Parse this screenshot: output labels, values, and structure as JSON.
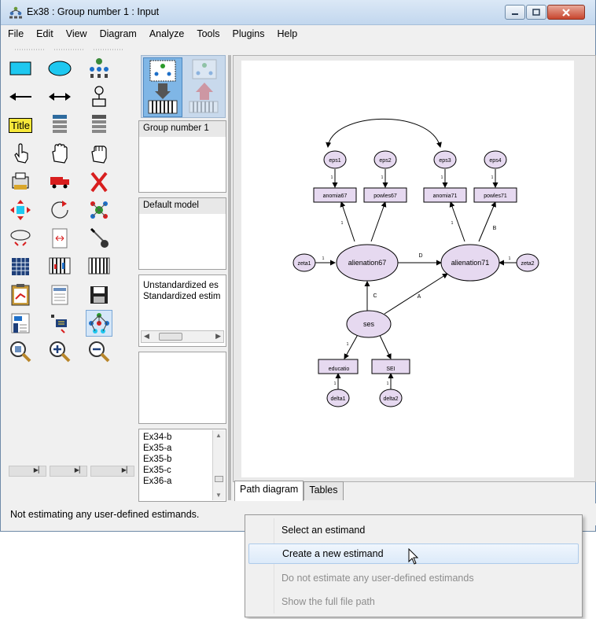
{
  "window": {
    "title": "Ex38 : Group number 1 : Input"
  },
  "menu": [
    "File",
    "Edit",
    "View",
    "Diagram",
    "Analyze",
    "Tools",
    "Plugins",
    "Help"
  ],
  "toolbox": {
    "title_tool_label": "Title",
    "icons": [
      "rectangle-icon",
      "ellipse-icon",
      "indicator-icon",
      "single-arrow-icon",
      "double-arrow-icon",
      "unique-variable-icon",
      "title-icon",
      "list-variables-icon",
      "list-dataset-icon",
      "select-one-icon",
      "select-all-icon",
      "deselect-all-icon",
      "duplicate-icon",
      "move-icon",
      "erase-icon",
      "shape-change-icon",
      "rotate-icon",
      "reflect-icon",
      "move-parameters-icon",
      "reposition-icon",
      "touch-up-icon",
      "data-files-icon",
      "analysis-properties-icon",
      "calculate-estimates-icon",
      "clipboard-icon",
      "text-output-icon",
      "save-icon",
      "object-properties-icon",
      "drag-properties-icon",
      "preserve-symmetries-icon",
      "zoom-select-icon",
      "zoom-in-icon",
      "zoom-out-icon"
    ]
  },
  "panels": {
    "groups": [
      "Group number 1"
    ],
    "models": [
      "Default model"
    ],
    "estimates": [
      "Unstandardized es",
      "Standardized estim"
    ],
    "files": [
      "Ex34-b",
      "Ex35-a",
      "Ex35-b",
      "Ex35-c",
      "Ex36-a"
    ]
  },
  "diagram": {
    "nodes": {
      "eps1": "eps1",
      "eps2": "eps2",
      "eps3": "eps3",
      "eps4": "eps4",
      "anomia67": "anomia67",
      "powles67": "powles67",
      "anomia71": "anomia71",
      "powles71": "powles71",
      "zeta1": "zeta1",
      "zeta2": "zeta2",
      "alienation67": "alienation67",
      "alienation71": "alienation71",
      "ses": "ses",
      "educatio": "educatio",
      "SEI": "SEI",
      "delta1": "delta1",
      "delta2": "delta2"
    },
    "path_labels": {
      "D": "D",
      "C": "C",
      "A": "A",
      "B": "B",
      "one": "1"
    }
  },
  "tabs": [
    "Path diagram",
    "Tables"
  ],
  "status": "Not estimating any user-defined estimands.",
  "context_menu": {
    "items": [
      {
        "label": "Select an estimand",
        "enabled": true
      },
      {
        "label": "Create a new estimand",
        "enabled": true,
        "highlighted": true
      },
      {
        "label": "Do not estimate any user-defined estimands",
        "enabled": false
      },
      {
        "label": "Show the full file path",
        "enabled": false
      }
    ]
  },
  "colors": {
    "node_fill": "#e6d9f0",
    "highlight": "#dceaf9"
  }
}
